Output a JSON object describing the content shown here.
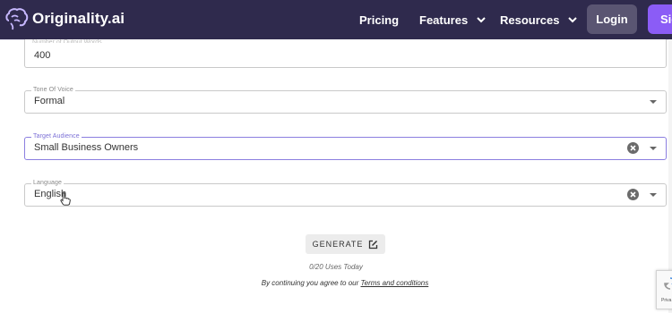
{
  "nav": {
    "brand": "Originality.ai",
    "links": [
      {
        "label": "Pricing",
        "dropdown": false
      },
      {
        "label": "Features",
        "dropdown": true
      },
      {
        "label": "Resources",
        "dropdown": true
      }
    ],
    "login_label": "Login",
    "signup_label": "Sig"
  },
  "form": {
    "words": {
      "label_partial": "Number of Output Words",
      "value": "400"
    },
    "tone": {
      "label": "Tone Of Voice",
      "value": "Formal"
    },
    "audience": {
      "label": "Target Audience",
      "value": "Small Business Owners"
    },
    "language": {
      "label": "Language",
      "value": "English"
    }
  },
  "generate_label": "GENERATE",
  "uses_text": "0/20 Uses Today",
  "terms_prefix": "By continuing you agree to our",
  "terms_link": "Terms and conditions",
  "recaptcha_text": "Priva",
  "colors": {
    "nav_bg": "#2f2a4d",
    "accent": "#8b5cf6",
    "login_bg": "#5a5572",
    "focus_border": "#8b7ee0"
  },
  "icons": {
    "brand": "brain-icon",
    "generate": "edit-icon",
    "clear": "clear-icon",
    "dropdown": "chevron-down-icon"
  }
}
